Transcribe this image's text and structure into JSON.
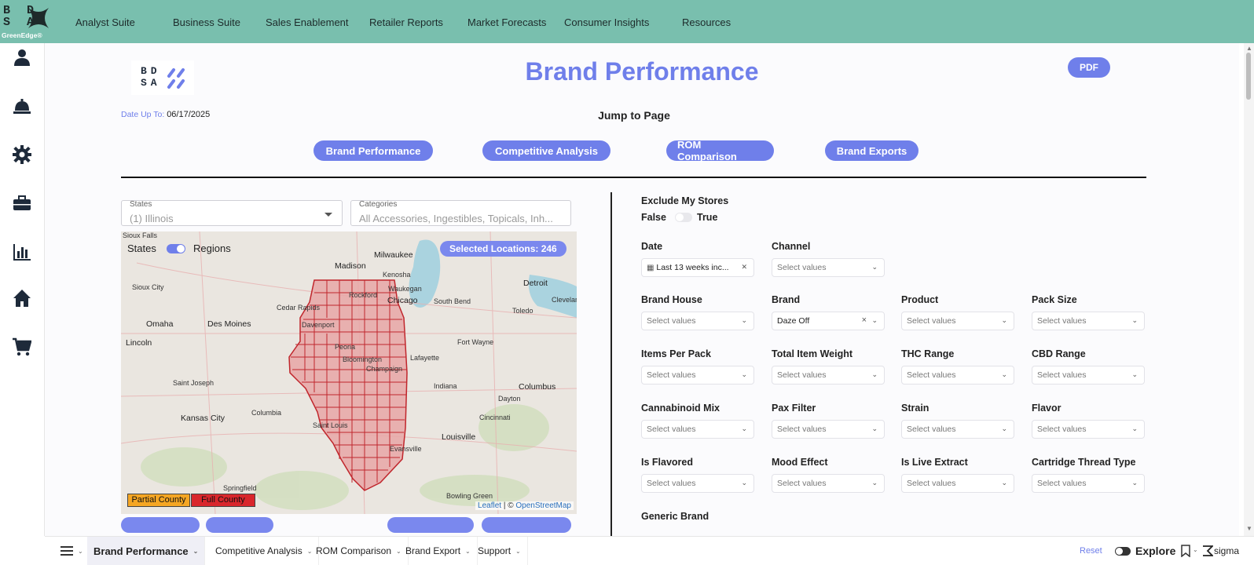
{
  "topnav": {
    "logo_text": "BDSA",
    "logo_sub": "GreenEdge®",
    "items": [
      "Analyst Suite",
      "Business Suite",
      "Sales Enablement",
      "Retailer Reports",
      "Market Forecasts",
      "Consumer Insights",
      "Resources"
    ]
  },
  "sidebar": {
    "icons": [
      "user-icon",
      "service-bell-icon",
      "gear-icon",
      "briefcase-icon",
      "bar-chart-icon",
      "home-icon",
      "cart-icon"
    ]
  },
  "header": {
    "brand_logo": "BDSA",
    "title": "Brand Performance",
    "pdf_label": "PDF",
    "date_label": "Date Up To:",
    "date_value": "06/17/2025",
    "jump_label": "Jump to Page"
  },
  "jump_buttons": [
    "Brand Performance",
    "Competitive Analysis",
    "ROM Comparison",
    "Brand Exports"
  ],
  "states_dd": {
    "label": "States",
    "value": "(1) Illinois"
  },
  "categories_dd": {
    "label": "Categories",
    "value": "All Accessories, Ingestibles, Topicals, Inh..."
  },
  "map": {
    "states_label": "States",
    "regions_label": "Regions",
    "selected_locations": "Selected Locations: 246",
    "legend_partial": "Partial County",
    "legend_full": "Full County",
    "attrib_leaflet": "Leaflet",
    "attrib_sep": " | © ",
    "attrib_osm": "OpenStreetMap",
    "places": [
      "Sioux Falls",
      "Milwaukee",
      "Madison",
      "Kenosha",
      "Detroit",
      "Waukegan",
      "Chicago",
      "South Bend",
      "Toledo",
      "Cleveland",
      "Sioux City",
      "Cedar Rapids",
      "Omaha",
      "Des Moines",
      "Davenport",
      "Rockford",
      "Peoria",
      "Fort Wayne",
      "Lincoln",
      "Bloomington",
      "Champaign",
      "Lafayette",
      "Indiana",
      "Columbus",
      "Saint Joseph",
      "Dayton",
      "Kansas City",
      "Columbia",
      "Saint Louis",
      "Cincinnati",
      "Louisville",
      "Evansville",
      "Springfield",
      "Bowling Green"
    ]
  },
  "filters": {
    "exclude_label": "Exclude My Stores",
    "false_label": "False",
    "true_label": "True",
    "date_label": "Date",
    "date_value": "Last 13 weeks inc...",
    "channel_label": "Channel",
    "placeholder": "Select values",
    "brand_value": "Daze Off",
    "labels": [
      "Brand House",
      "Brand",
      "Product",
      "Pack Size",
      "Items Per Pack",
      "Total Item Weight",
      "THC Range",
      "CBD Range",
      "Cannabinoid Mix",
      "Pax Filter",
      "Strain",
      "Flavor",
      "Is Flavored",
      "Mood Effect",
      "Is Live Extract",
      "Cartridge Thread Type",
      "Generic Brand"
    ]
  },
  "bottombar": {
    "tabs": [
      "Brand Performance",
      "Competitive Analysis",
      "ROM Comparison",
      "Brand Export",
      "Support"
    ],
    "reset": "Reset",
    "explore": "Explore",
    "sigma": "sigma"
  },
  "colors": {
    "nav_bg": "#79bfae",
    "accent": "#6f7fea",
    "county_fill": "#e8a6a6",
    "county_stroke": "#c0262c"
  }
}
